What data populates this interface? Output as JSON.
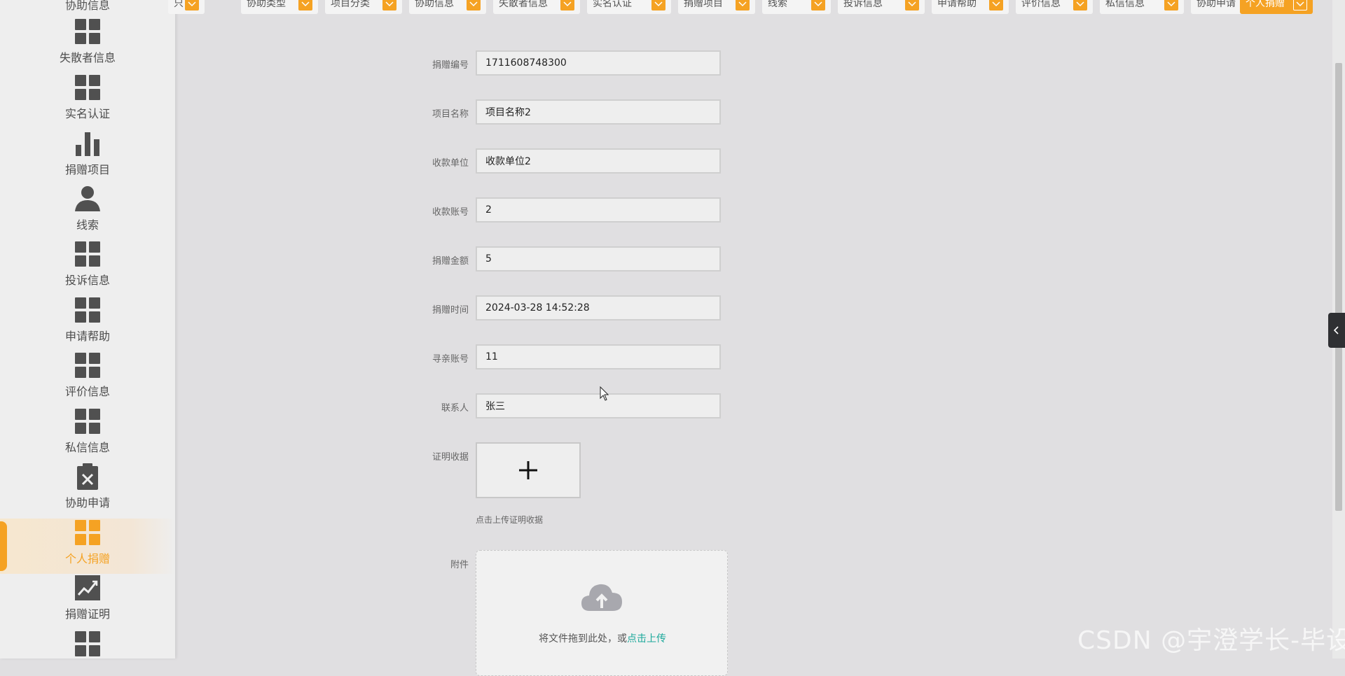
{
  "sidebar": {
    "top_cut_label": "协助信息",
    "items": [
      {
        "label": "失散者信息",
        "icon": "grid-icon"
      },
      {
        "label": "实名认证",
        "icon": "grid-icon"
      },
      {
        "label": "捐赠项目",
        "icon": "bar-chart-icon"
      },
      {
        "label": "线索",
        "icon": "user-icon"
      },
      {
        "label": "投诉信息",
        "icon": "grid-icon"
      },
      {
        "label": "申请帮助",
        "icon": "grid-icon"
      },
      {
        "label": "评价信息",
        "icon": "grid-icon"
      },
      {
        "label": "私信信息",
        "icon": "grid-icon"
      },
      {
        "label": "协助申请",
        "icon": "clipboard-x-icon"
      },
      {
        "label": "个人捐赠",
        "icon": "grid-icon",
        "active": true
      },
      {
        "label": "捐赠证明",
        "icon": "trend-chart-icon"
      },
      {
        "label": "",
        "icon": "grid-icon"
      }
    ]
  },
  "tabs": [
    {
      "label": "只"
    },
    {
      "label": "协助类型"
    },
    {
      "label": "项目分类"
    },
    {
      "label": "协助信息"
    },
    {
      "label": "失散者信息"
    },
    {
      "label": "实名认证"
    },
    {
      "label": "捐赠项目"
    },
    {
      "label": "线索"
    },
    {
      "label": "投诉信息"
    },
    {
      "label": "申请帮助"
    },
    {
      "label": "评价信息"
    },
    {
      "label": "私信信息"
    },
    {
      "label": "协助申请"
    },
    {
      "label": "个人捐赠",
      "active": true
    }
  ],
  "form": {
    "fields": [
      {
        "label": "捐赠编号",
        "value": "1711608748300"
      },
      {
        "label": "项目名称",
        "value": "项目名称2"
      },
      {
        "label": "收款单位",
        "value": "收款单位2"
      },
      {
        "label": "收款账号",
        "value": "2"
      },
      {
        "label": "捐赠金额",
        "value": "5"
      },
      {
        "label": "捐赠时间",
        "value": "2024-03-28 14:52:28"
      },
      {
        "label": "寻亲账号",
        "value": "11"
      },
      {
        "label": "联系人",
        "value": "张三"
      }
    ],
    "receipt": {
      "label": "证明收据",
      "hint": "点击上传证明收据"
    },
    "attachment": {
      "label": "附件",
      "drag_text": "将文件拖到此处，或",
      "click_text": "点击上传"
    }
  },
  "watermark": "CSDN @宇澄学长-毕设",
  "colors": {
    "accent": "#f5a223",
    "link": "#1aa89a",
    "background": "#e0dfe1"
  }
}
